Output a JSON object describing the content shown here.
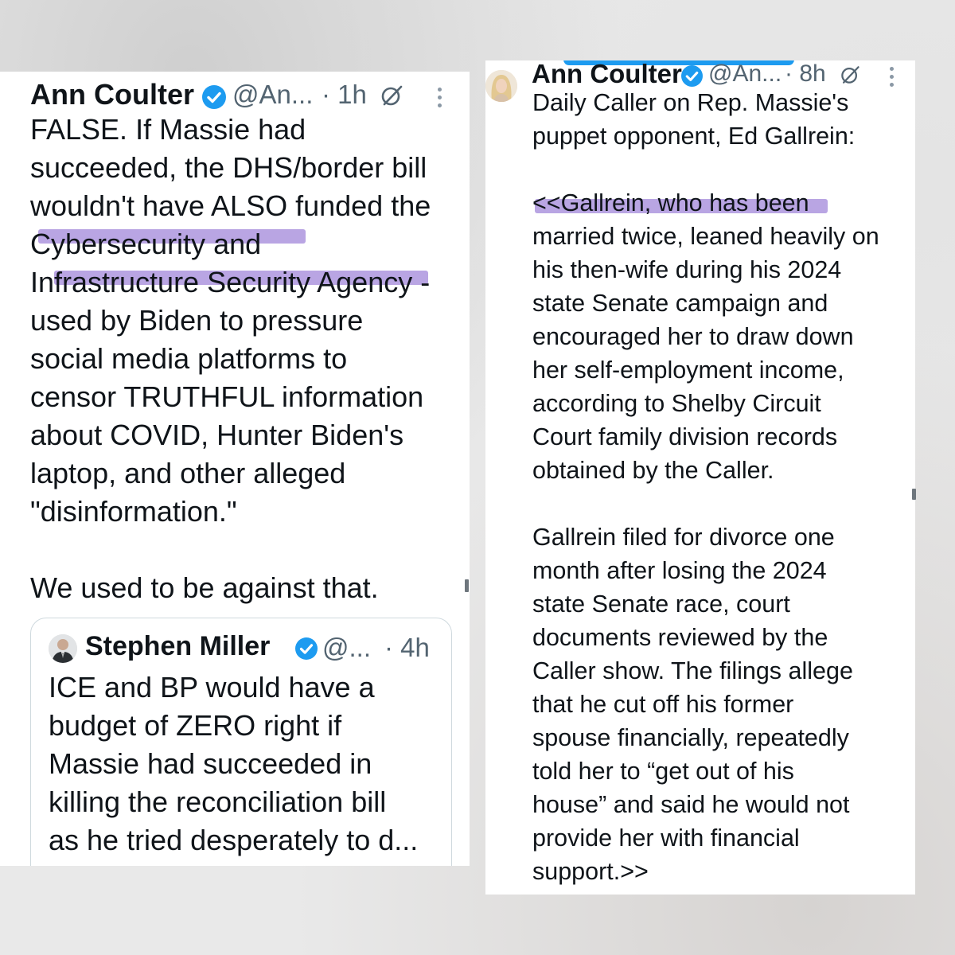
{
  "left_post": {
    "author": "Ann Coulter",
    "handle": "@An...",
    "time": "· 1h",
    "lines": [
      "FALSE.  If Massie had",
      "succeeded, the DHS/border bill",
      "wouldn't have ALSO funded the",
      "Cybersecurity and",
      "Infrastructure Security Agency -",
      "used by Biden to pressure",
      "social media platforms to",
      "censor TRUTHFUL information",
      "about COVID, Hunter Biden's",
      "laptop, and other alleged",
      "\"disinformation.\"",
      "",
      "We used to be against that."
    ],
    "quoted": {
      "author": "Stephen Miller",
      "handle": "@...",
      "time": "· 4h",
      "lines": [
        "ICE and BP would have a",
        "budget of ZERO right if",
        "Massie had succeeded in",
        "killing the reconciliation bill",
        "as he tried desperately to d..."
      ]
    }
  },
  "right_post": {
    "author": "Ann Coulter",
    "handle": "@An...",
    "time": "· 8h",
    "lines": [
      "Daily Caller on Rep. Massie's",
      "puppet opponent, Ed Gallrein:",
      "",
      "<<Gallrein, who has been",
      "married twice, leaned heavily on",
      "his then-wife during his 2024",
      "state Senate campaign and",
      "encouraged her to draw down",
      "her self-employment income,",
      "according to Shelby Circuit",
      "Court family division records",
      "obtained by the Caller.",
      "",
      "Gallrein filed for divorce one",
      "month after losing the 2024",
      "state Senate race, court",
      "documents reviewed by the",
      "Caller show. The filings allege",
      "that he cut off his former",
      "spouse financially, repeatedly",
      "told her to “get out of his",
      "house” and said he would not",
      "provide her with financial",
      "support.>>"
    ]
  },
  "icons": {
    "verified": "verified-badge-icon",
    "grok": "grok-icon",
    "more": "more-options-icon"
  },
  "colors": {
    "highlight": "#b9a5e3",
    "verified": "#1d9bf0",
    "text": "#0f1419",
    "secondary": "#536471"
  }
}
